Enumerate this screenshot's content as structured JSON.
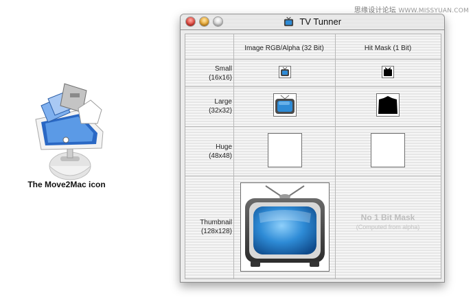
{
  "watermark": {
    "site_name": "思缘设计论坛",
    "site_url": "WWW.MISSYUAN.COM"
  },
  "left_icon": {
    "caption": "The Move2Mac icon"
  },
  "window": {
    "title": "TV Tunner",
    "columns": [
      "Image RGB/Alpha (32 Bit)",
      "Hit Mask (1 Bit)"
    ],
    "rows": [
      {
        "name": "Small",
        "size": "(16x16)"
      },
      {
        "name": "Large",
        "size": "(32x32)"
      },
      {
        "name": "Huge",
        "size": "(48x48)"
      },
      {
        "name": "Thumbnail",
        "size": "(128x128)"
      }
    ],
    "no_mask_title": "No 1 Bit Mask",
    "no_mask_subtitle": "(Computed from alpha)"
  },
  "colors": {
    "screen_blue": "#2e8bd6",
    "tv_body": "#4a4a4a",
    "close": "#e0433a",
    "minimize": "#e8a52e"
  },
  "icons": [
    "close-icon",
    "minimize-icon",
    "zoom-icon",
    "tv-icon"
  ]
}
